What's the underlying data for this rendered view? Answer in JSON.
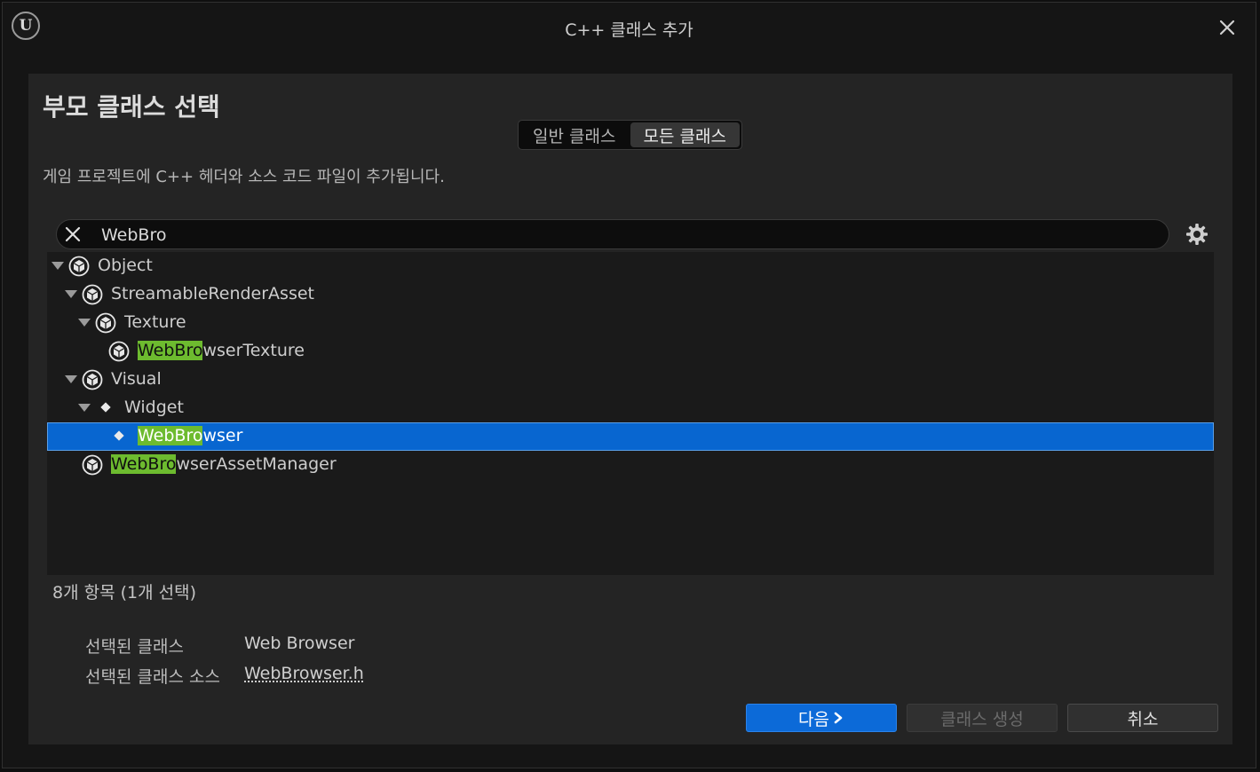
{
  "window": {
    "title": "C++ 클래스 추가",
    "logo": "U"
  },
  "panel": {
    "heading": "부모 클래스 선택",
    "toggle": {
      "common": "일반 클래스",
      "all": "모든 클래스",
      "active": "all"
    },
    "description": "게임 프로젝트에 C++ 헤더와 소스 코드 파일이 추가됩니다."
  },
  "search": {
    "value": "WebBro"
  },
  "tree": {
    "rows": [
      {
        "match": "",
        "rest": "Object",
        "icon": "class-icon",
        "expanded": true,
        "selected": false
      },
      {
        "match": "",
        "rest": "StreamableRenderAsset",
        "icon": "class-icon",
        "expanded": true,
        "selected": false
      },
      {
        "match": "",
        "rest": "Texture",
        "icon": "class-icon",
        "expanded": true,
        "selected": false
      },
      {
        "match": "WebBro",
        "rest": "wserTexture",
        "icon": "class-icon",
        "expanded": false,
        "selected": false
      },
      {
        "match": "",
        "rest": "Visual",
        "icon": "class-icon",
        "expanded": true,
        "selected": false
      },
      {
        "match": "",
        "rest": "Widget",
        "icon": "widget-icon",
        "expanded": true,
        "selected": false
      },
      {
        "match": "WebBro",
        "rest": "wser",
        "icon": "widget-icon",
        "expanded": false,
        "selected": true
      },
      {
        "match": "WebBro",
        "rest": "wserAssetManager",
        "icon": "class-icon",
        "expanded": false,
        "selected": false
      }
    ]
  },
  "status": {
    "count": "8개 항목 (1개 선택)"
  },
  "info": {
    "selected_class_label": "선택된 클래스",
    "selected_class_value": "Web Browser",
    "selected_source_label": "선택된 클래스 소스",
    "selected_source_value": "WebBrowser.h"
  },
  "buttons": {
    "next": "다음",
    "create": "클래스 생성",
    "cancel": "취소"
  },
  "colors": {
    "accent": "#0866d0",
    "highlight": "#6dbb2f",
    "panel": "#242424"
  }
}
